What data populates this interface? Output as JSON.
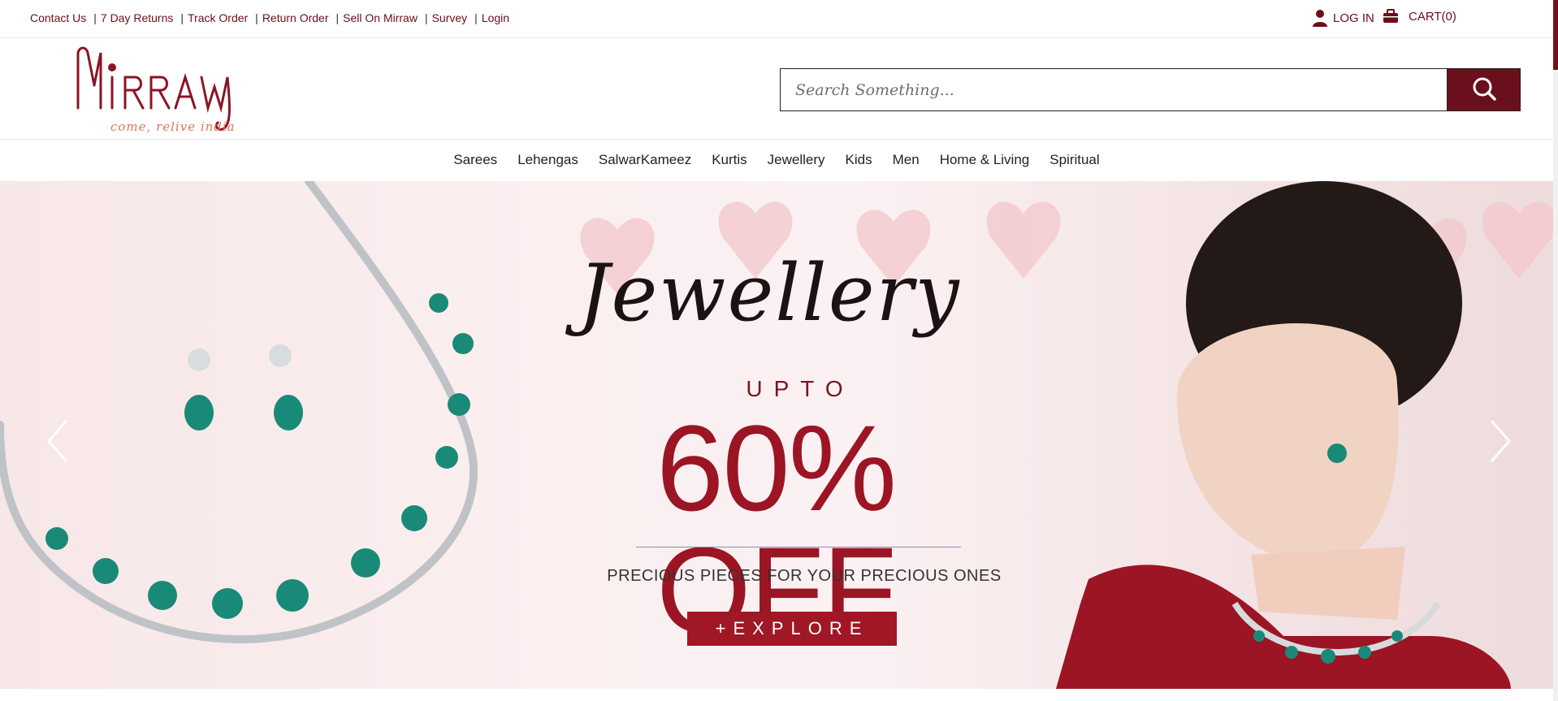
{
  "topbar": {
    "links": [
      "Contact Us",
      "7 Day Returns",
      "Track Order",
      "Return Order",
      "Sell On Mirraw",
      "Survey",
      "Login"
    ],
    "login_label": "LOG IN",
    "cart_label": "CART(0)"
  },
  "header": {
    "logo_text": "MIRRAW",
    "logo_tagline": "come, relive india",
    "search_placeholder": "Search Something..."
  },
  "nav": {
    "items": [
      "Sarees",
      "Lehengas",
      "SalwarKameez",
      "Kurtis",
      "Jewellery",
      "Kids",
      "Men",
      "Home & Living",
      "Spiritual"
    ]
  },
  "banner": {
    "script_title": "Jewellery",
    "upto": "UPTO",
    "discount": "60% OFF",
    "tagline": "PRECIOUS PIECES FOR YOUR PRECIOUS ONES",
    "cta": "+EXPLORE"
  },
  "colors": {
    "brand": "#6a0f1c",
    "accent": "#a01725",
    "link": "#6b0f1a"
  },
  "icons": [
    "user-icon",
    "cart-icon",
    "search-icon",
    "chevron-left-icon",
    "chevron-right-icon"
  ]
}
